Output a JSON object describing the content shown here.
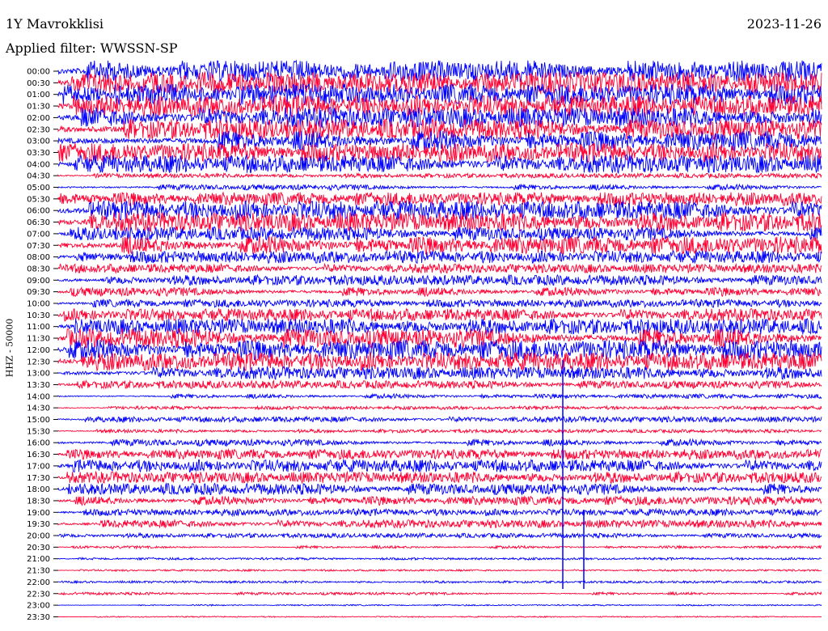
{
  "header": {
    "station": "1Y Mavrokklisi",
    "date": "2023-11-26",
    "filter_text": "Applied filter: WWSSN-SP"
  },
  "chart_data": {
    "type": "line",
    "title": "1Y Mavrokklisi",
    "subtitle": "Applied filter: WWSSN-SP",
    "ylabel": "HHZ - 50000",
    "xlabel": "",
    "date": "2023-11-26",
    "colors": [
      "#0000ff",
      "#ff0033"
    ],
    "rows": [
      {
        "label": "00:00",
        "color": "#0000ff",
        "amplitude": 0.95
      },
      {
        "label": "00:30",
        "color": "#ff0033",
        "amplitude": 0.95
      },
      {
        "label": "01:00",
        "color": "#0000ff",
        "amplitude": 0.95
      },
      {
        "label": "01:30",
        "color": "#ff0033",
        "amplitude": 0.95
      },
      {
        "label": "02:00",
        "color": "#0000ff",
        "amplitude": 0.9
      },
      {
        "label": "02:30",
        "color": "#ff0033",
        "amplitude": 0.9
      },
      {
        "label": "03:00",
        "color": "#0000ff",
        "amplitude": 0.9
      },
      {
        "label": "03:30",
        "color": "#ff0033",
        "amplitude": 0.85
      },
      {
        "label": "04:00",
        "color": "#0000ff",
        "amplitude": 0.8
      },
      {
        "label": "04:30",
        "color": "#ff0033",
        "amplitude": 0.2
      },
      {
        "label": "05:00",
        "color": "#0000ff",
        "amplitude": 0.25
      },
      {
        "label": "05:30",
        "color": "#ff0033",
        "amplitude": 0.6
      },
      {
        "label": "06:00",
        "color": "#0000ff",
        "amplitude": 0.85
      },
      {
        "label": "06:30",
        "color": "#ff0033",
        "amplitude": 0.85
      },
      {
        "label": "07:00",
        "color": "#0000ff",
        "amplitude": 0.6
      },
      {
        "label": "07:30",
        "color": "#ff0033",
        "amplitude": 0.8
      },
      {
        "label": "08:00",
        "color": "#0000ff",
        "amplitude": 0.55
      },
      {
        "label": "08:30",
        "color": "#ff0033",
        "amplitude": 0.4
      },
      {
        "label": "09:00",
        "color": "#0000ff",
        "amplitude": 0.45
      },
      {
        "label": "09:30",
        "color": "#ff0033",
        "amplitude": 0.4
      },
      {
        "label": "10:00",
        "color": "#0000ff",
        "amplitude": 0.35
      },
      {
        "label": "10:30",
        "color": "#ff0033",
        "amplitude": 0.55
      },
      {
        "label": "11:00",
        "color": "#0000ff",
        "amplitude": 0.7
      },
      {
        "label": "11:30",
        "color": "#ff0033",
        "amplitude": 0.85
      },
      {
        "label": "12:00",
        "color": "#0000ff",
        "amplitude": 0.9
      },
      {
        "label": "12:30",
        "color": "#ff0033",
        "amplitude": 0.8
      },
      {
        "label": "13:00",
        "color": "#0000ff",
        "amplitude": 0.55
      },
      {
        "label": "13:30",
        "color": "#ff0033",
        "amplitude": 0.35
      },
      {
        "label": "14:00",
        "color": "#0000ff",
        "amplitude": 0.2
      },
      {
        "label": "14:30",
        "color": "#ff0033",
        "amplitude": 0.15
      },
      {
        "label": "15:00",
        "color": "#0000ff",
        "amplitude": 0.25
      },
      {
        "label": "15:30",
        "color": "#ff0033",
        "amplitude": 0.15
      },
      {
        "label": "16:00",
        "color": "#0000ff",
        "amplitude": 0.3
      },
      {
        "label": "16:30",
        "color": "#ff0033",
        "amplitude": 0.45
      },
      {
        "label": "17:00",
        "color": "#0000ff",
        "amplitude": 0.55
      },
      {
        "label": "17:30",
        "color": "#ff0033",
        "amplitude": 0.5
      },
      {
        "label": "18:00",
        "color": "#0000ff",
        "amplitude": 0.5
      },
      {
        "label": "18:30",
        "color": "#ff0033",
        "amplitude": 0.4
      },
      {
        "label": "19:00",
        "color": "#0000ff",
        "amplitude": 0.3
      },
      {
        "label": "19:30",
        "color": "#ff0033",
        "amplitude": 0.35
      },
      {
        "label": "20:00",
        "color": "#0000ff",
        "amplitude": 0.2
      },
      {
        "label": "20:30",
        "color": "#ff0033",
        "amplitude": 0.12
      },
      {
        "label": "21:00",
        "color": "#0000ff",
        "amplitude": 0.1
      },
      {
        "label": "21:30",
        "color": "#ff0033",
        "amplitude": 0.08
      },
      {
        "label": "22:00",
        "color": "#0000ff",
        "amplitude": 0.1
      },
      {
        "label": "22:30",
        "color": "#ff0033",
        "amplitude": 0.12
      },
      {
        "label": "23:00",
        "color": "#0000ff",
        "amplitude": 0.06
      },
      {
        "label": "23:30",
        "color": "#ff0033",
        "amplitude": 0.05
      }
    ]
  }
}
